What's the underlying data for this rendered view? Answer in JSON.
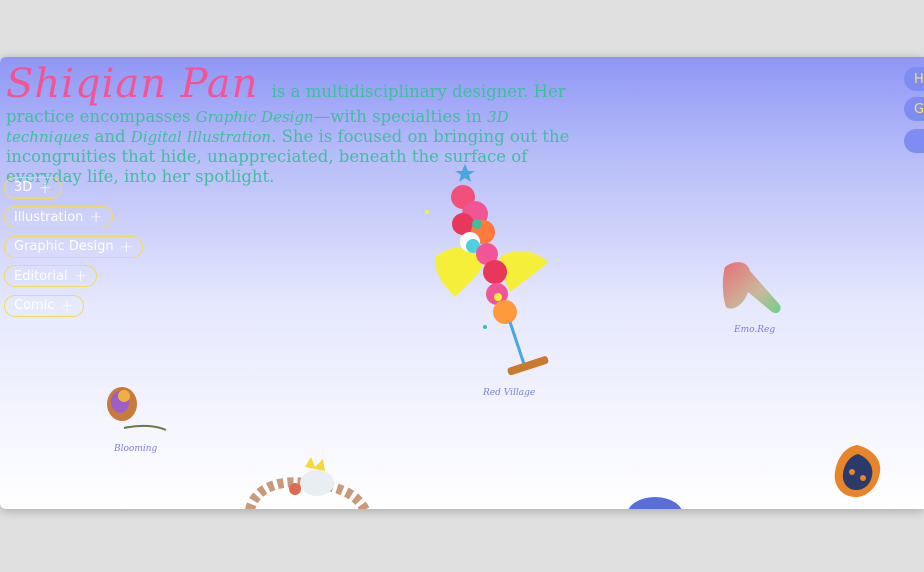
{
  "intro": {
    "name": "Shiqian Pan",
    "text_1": "is a multidisciplinary designer. Her practice encompasses",
    "graphic_design": "Graphic Design",
    "text_2": "—with specialties in",
    "three_d": "3D techniques",
    "and": "and",
    "digital_illustration": "Digital Illustration",
    "text_3": ". She is focused on bringing out the incongruities that hide, unappreciated, beneath the surface of everyday life, into her spotlight."
  },
  "filters": [
    {
      "label": "3D",
      "icon": "plus-icon"
    },
    {
      "label": "Illustration",
      "icon": "plus-icon"
    },
    {
      "label": "Graphic Design",
      "icon": "plus-icon"
    },
    {
      "label": "Editorial",
      "icon": "plus-icon"
    },
    {
      "label": "Comic",
      "icon": "plus-icon"
    }
  ],
  "side_buttons": [
    "H",
    "G",
    ""
  ],
  "projects": {
    "red_village": "Red Village",
    "emo_reg": "Emo.Reg",
    "blooming": "Blooming"
  },
  "colors": {
    "name": "#f25596",
    "body_text": "#3fbf9c",
    "pill_border": "#f1dd55",
    "side_button": "#7f8cf2"
  }
}
